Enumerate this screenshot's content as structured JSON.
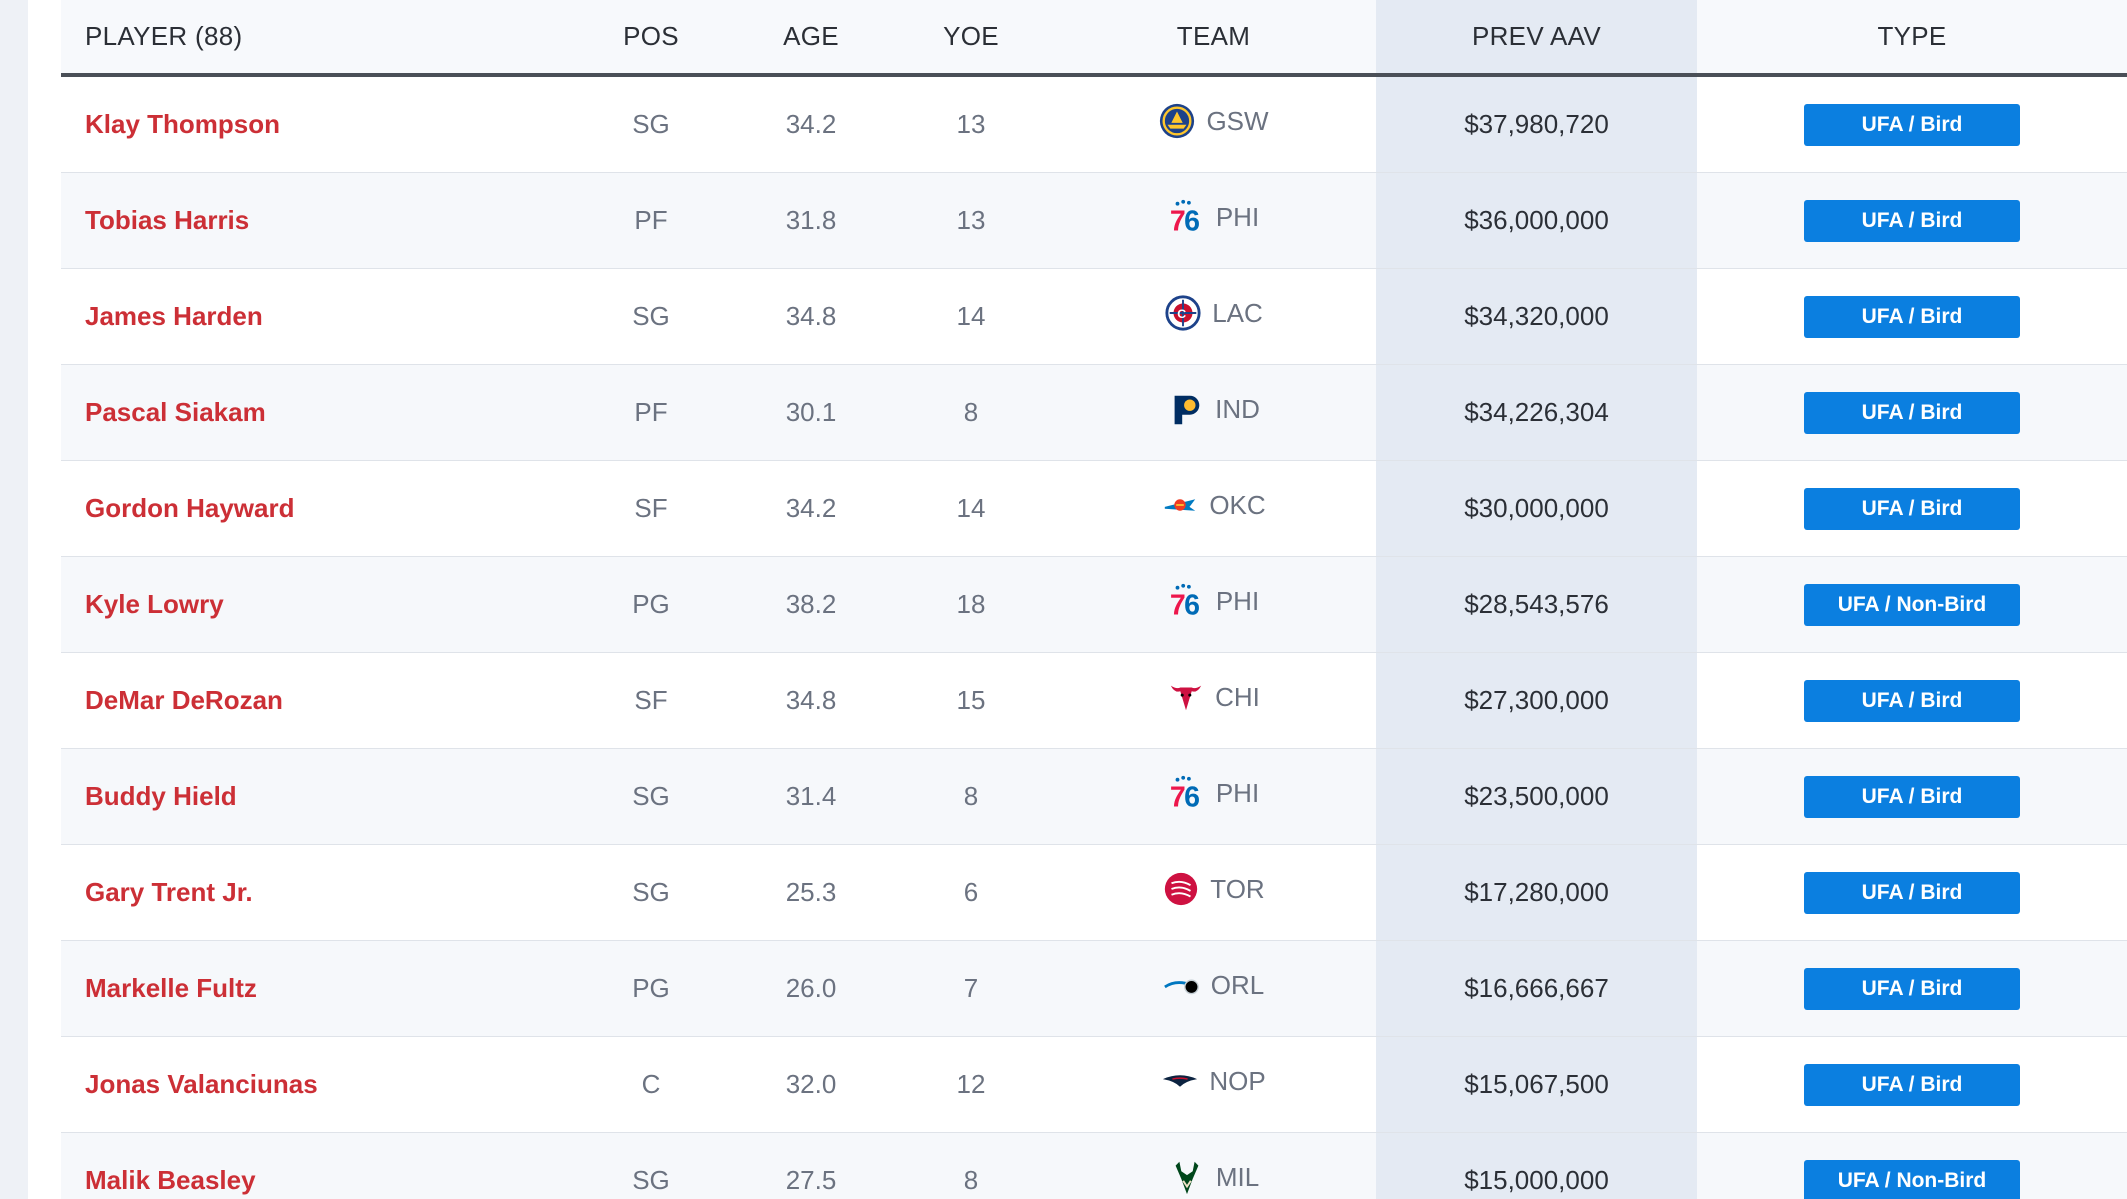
{
  "table": {
    "headers": {
      "player": "PLAYER (88)",
      "pos": "POS",
      "age": "AGE",
      "yoe": "YOE",
      "team": "TEAM",
      "prev_aav": "PREV AAV",
      "type": "TYPE"
    },
    "rows": [
      {
        "player": "Klay Thompson",
        "pos": "SG",
        "age": "34.2",
        "yoe": "13",
        "team": "GSW",
        "team_logo": "warriors-logo-icon",
        "prev_aav": "$37,980,720",
        "type": "UFA / Bird"
      },
      {
        "player": "Tobias Harris",
        "pos": "PF",
        "age": "31.8",
        "yoe": "13",
        "team": "PHI",
        "team_logo": "76ers-logo-icon",
        "prev_aav": "$36,000,000",
        "type": "UFA / Bird"
      },
      {
        "player": "James Harden",
        "pos": "SG",
        "age": "34.8",
        "yoe": "14",
        "team": "LAC",
        "team_logo": "clippers-logo-icon",
        "prev_aav": "$34,320,000",
        "type": "UFA / Bird"
      },
      {
        "player": "Pascal Siakam",
        "pos": "PF",
        "age": "30.1",
        "yoe": "8",
        "team": "IND",
        "team_logo": "pacers-logo-icon",
        "prev_aav": "$34,226,304",
        "type": "UFA / Bird"
      },
      {
        "player": "Gordon Hayward",
        "pos": "SF",
        "age": "34.2",
        "yoe": "14",
        "team": "OKC",
        "team_logo": "thunder-logo-icon",
        "prev_aav": "$30,000,000",
        "type": "UFA / Bird"
      },
      {
        "player": "Kyle Lowry",
        "pos": "PG",
        "age": "38.2",
        "yoe": "18",
        "team": "PHI",
        "team_logo": "76ers-logo-icon",
        "prev_aav": "$28,543,576",
        "type": "UFA / Non-Bird"
      },
      {
        "player": "DeMar DeRozan",
        "pos": "SF",
        "age": "34.8",
        "yoe": "15",
        "team": "CHI",
        "team_logo": "bulls-logo-icon",
        "prev_aav": "$27,300,000",
        "type": "UFA / Bird"
      },
      {
        "player": "Buddy Hield",
        "pos": "SG",
        "age": "31.4",
        "yoe": "8",
        "team": "PHI",
        "team_logo": "76ers-logo-icon",
        "prev_aav": "$23,500,000",
        "type": "UFA / Bird"
      },
      {
        "player": "Gary Trent Jr.",
        "pos": "SG",
        "age": "25.3",
        "yoe": "6",
        "team": "TOR",
        "team_logo": "raptors-logo-icon",
        "prev_aav": "$17,280,000",
        "type": "UFA / Bird"
      },
      {
        "player": "Markelle Fultz",
        "pos": "PG",
        "age": "26.0",
        "yoe": "7",
        "team": "ORL",
        "team_logo": "magic-logo-icon",
        "prev_aav": "$16,666,667",
        "type": "UFA / Bird"
      },
      {
        "player": "Jonas Valanciunas",
        "pos": "C",
        "age": "32.0",
        "yoe": "12",
        "team": "NOP",
        "team_logo": "pelicans-logo-icon",
        "prev_aav": "$15,067,500",
        "type": "UFA / Bird"
      },
      {
        "player": "Malik Beasley",
        "pos": "SG",
        "age": "27.5",
        "yoe": "8",
        "team": "MIL",
        "team_logo": "bucks-logo-icon",
        "prev_aav": "$15,000,000",
        "type": "UFA / Non-Bird"
      }
    ]
  },
  "colors": {
    "player_link": "#cc2f36",
    "badge": "#0b7fe0",
    "highlight_column": "#e4eaf3"
  }
}
